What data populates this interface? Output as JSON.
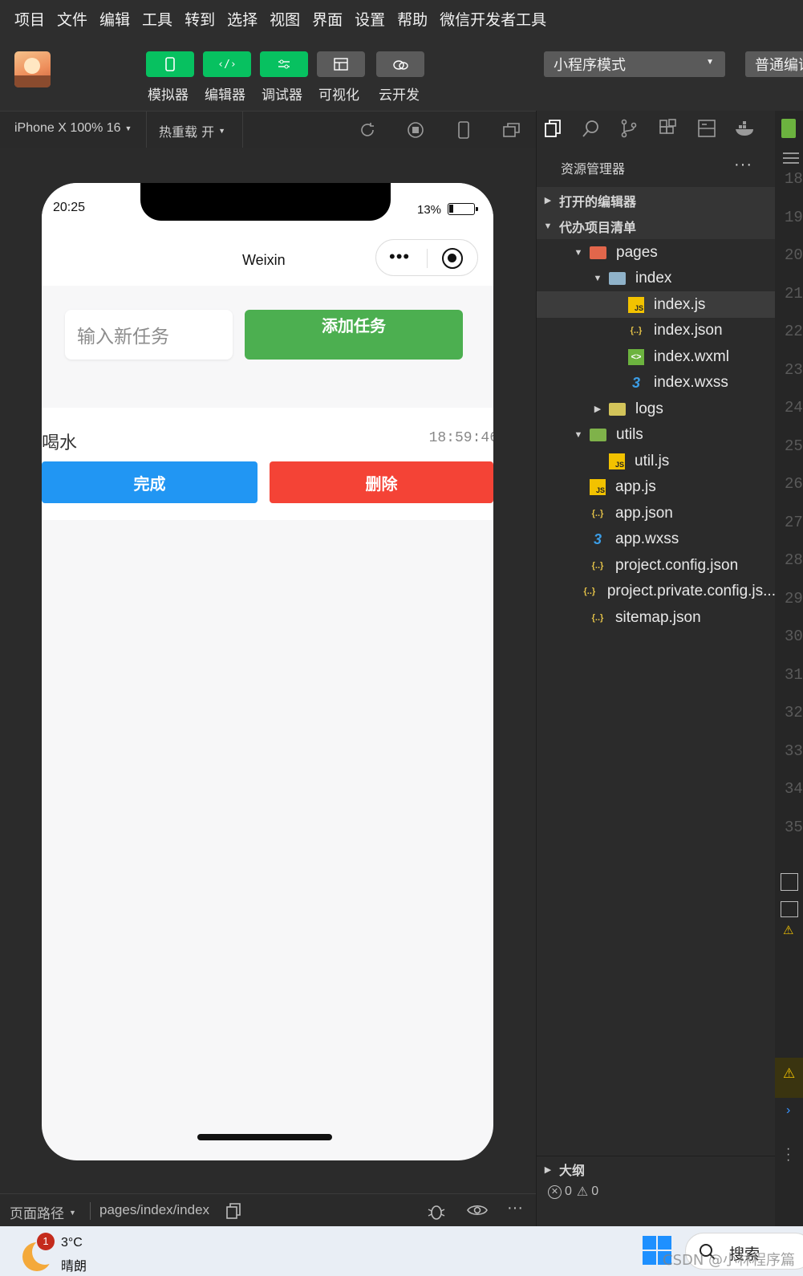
{
  "menubar": [
    "项目",
    "文件",
    "编辑",
    "工具",
    "转到",
    "选择",
    "视图",
    "界面",
    "设置",
    "帮助",
    "微信开发者工具"
  ],
  "toolbar": {
    "buttons": [
      {
        "label": "模拟器",
        "icon": "phone-icon",
        "color": "#07c160"
      },
      {
        "label": "编辑器",
        "icon": "code-icon",
        "color": "#07c160"
      },
      {
        "label": "调试器",
        "icon": "sliders-icon",
        "color": "#07c160"
      },
      {
        "label": "可视化",
        "icon": "layout-icon",
        "color": "#5b5b5b"
      },
      {
        "label": "云开发",
        "icon": "cloud-icon",
        "color": "#5b5b5b"
      }
    ],
    "mode_select": "小程序模式",
    "compile_select": "普通编译"
  },
  "simulator": {
    "device": "iPhone X 100% 16",
    "hot_reload": "热重载 开"
  },
  "phone": {
    "time": "20:25",
    "battery": "13%",
    "nav_title": "Weixin",
    "input_placeholder": "输入新任务",
    "add_button": "添加任务",
    "task": {
      "name": "喝水",
      "time": "18:59:46"
    },
    "done_button": "完成",
    "delete_button": "删除"
  },
  "explorer": {
    "title": "资源管理器",
    "open_editors": "打开的编辑器",
    "project": "代办项目清单",
    "files": [
      {
        "name": "pages",
        "type": "folder-open",
        "indent": 1,
        "caret": "down"
      },
      {
        "name": "index",
        "type": "folder-open",
        "indent": 2,
        "caret": "down"
      },
      {
        "name": "index.js",
        "type": "js",
        "indent": 3,
        "selected": true
      },
      {
        "name": "index.json",
        "type": "json",
        "indent": 3
      },
      {
        "name": "index.wxml",
        "type": "wxml",
        "indent": 3
      },
      {
        "name": "index.wxss",
        "type": "wxss",
        "indent": 3
      },
      {
        "name": "logs",
        "type": "folder",
        "indent": 2,
        "caret": "right"
      },
      {
        "name": "utils",
        "type": "folder-open",
        "indent": 1,
        "caret": "down"
      },
      {
        "name": "util.js",
        "type": "js",
        "indent": 2
      },
      {
        "name": "app.js",
        "type": "js",
        "indent": 1
      },
      {
        "name": "app.json",
        "type": "json",
        "indent": 1
      },
      {
        "name": "app.wxss",
        "type": "wxss",
        "indent": 1
      },
      {
        "name": "project.config.json",
        "type": "json",
        "indent": 1
      },
      {
        "name": "project.private.config.js...",
        "type": "json",
        "indent": 1
      },
      {
        "name": "sitemap.json",
        "type": "json",
        "indent": 1
      }
    ],
    "outline": "大纲",
    "errors": "0",
    "warnings": "0"
  },
  "gutter_lines": [
    "18",
    "19",
    "20",
    "21",
    "22",
    "23",
    "24",
    "25",
    "26",
    "27",
    "28",
    "29",
    "30",
    "31",
    "32",
    "33",
    "34",
    "35"
  ],
  "statusbar": {
    "path_label": "页面路径",
    "path": "pages/index/index"
  },
  "taskbar": {
    "weather_badge": "1",
    "temperature": "3°C",
    "weather": "晴朗",
    "search": "搜索",
    "watermark": "CSDN @小林程序篇"
  },
  "colors": {
    "green": "#4caf50",
    "blue": "#2196f3",
    "red": "#f44336",
    "wechat_green": "#07c160"
  }
}
